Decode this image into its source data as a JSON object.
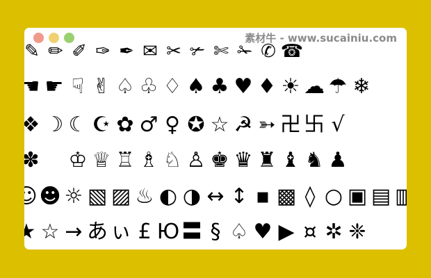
{
  "window": {
    "watermark": "素材牛 - www.sucainiu.com",
    "controls": {
      "close": "#ef9a8a",
      "minimize": "#f0d070",
      "zoom": "#9bd070"
    }
  },
  "glyph_rows": [
    [
      "✎",
      "✏",
      "✐",
      "✑",
      "✒",
      "✉",
      "✂",
      "✃",
      "✄",
      "✁",
      "✆",
      "☎"
    ],
    [
      "☚",
      "☛",
      "☟",
      "✌",
      "♤",
      "♧",
      "♢",
      "♠",
      "♣",
      "♥",
      "♦",
      "☀",
      "☁",
      "☂",
      "❄"
    ],
    [
      "❖",
      "☽",
      "☾",
      "☪",
      "✿",
      "♂",
      "♀",
      "✪",
      "☆",
      "☭",
      "➳",
      "卍",
      "卐",
      "√"
    ],
    [
      "✽",
      "",
      "♔",
      "♕",
      "♖",
      "♗",
      "♘",
      "♙",
      "♚",
      "♛",
      "♜",
      "♝",
      "♞",
      "♟"
    ],
    [
      "☺",
      "☻",
      "☼",
      "▧",
      "▨",
      "♨",
      "◐",
      "◑",
      "↔",
      "↕",
      "▪",
      "▩",
      "◊",
      "○",
      "▣",
      "▤",
      "▥",
      "▦"
    ],
    [
      "★",
      "☆",
      "→",
      "あ",
      "ぃ",
      "£",
      "Ю",
      "〓",
      "§",
      "♤",
      "♥",
      "▶",
      "¤",
      "✲",
      "❈"
    ]
  ]
}
